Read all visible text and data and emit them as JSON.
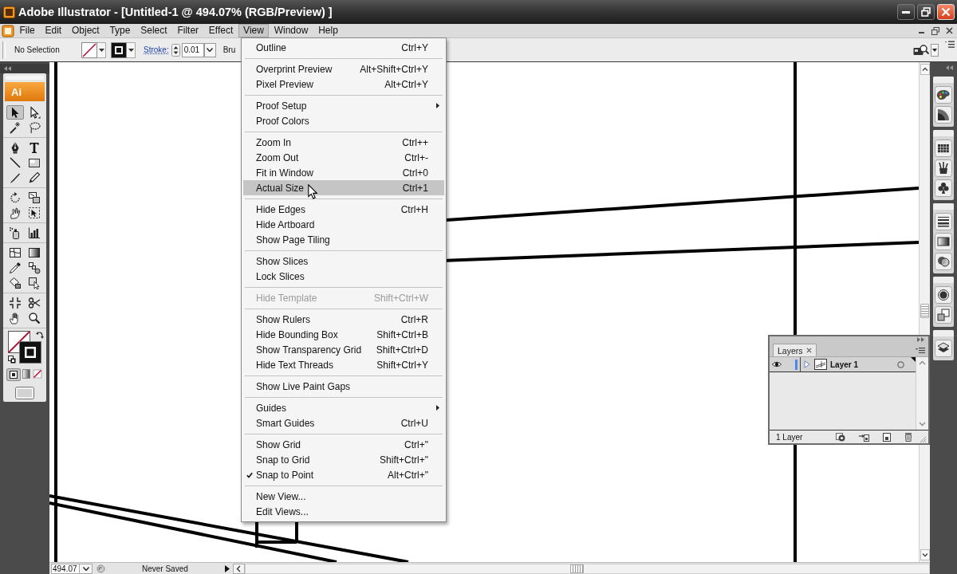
{
  "window": {
    "title": "Adobe Illustrator - [Untitled-1 @ 494.07% (RGB/Preview) ]"
  },
  "menu_bar": [
    {
      "label": "File",
      "selected": false
    },
    {
      "label": "Edit",
      "selected": false
    },
    {
      "label": "Object",
      "selected": false
    },
    {
      "label": "Type",
      "selected": false
    },
    {
      "label": "Select",
      "selected": false
    },
    {
      "label": "Filter",
      "selected": false
    },
    {
      "label": "Effect",
      "selected": false
    },
    {
      "label": "View",
      "selected": true
    },
    {
      "label": "Window",
      "selected": false
    },
    {
      "label": "Help",
      "selected": false
    }
  ],
  "control_bar": {
    "selection_status": "No Selection",
    "stroke_label": "Stroke:",
    "stroke_weight": "0.01",
    "label_4": "Bru"
  },
  "toolbox": {
    "logo": "Ai",
    "tool_groups": [
      [
        {
          "kind": "arrow",
          "selected": true
        },
        {
          "kind": "hollowarrow",
          "selected": false
        },
        {
          "kind": "wand",
          "selected": false
        },
        {
          "kind": "lasso",
          "selected": false
        }
      ],
      [
        {
          "kind": "pen",
          "selected": false
        },
        {
          "kind": "type",
          "selected": false
        },
        {
          "kind": "line",
          "selected": false
        },
        {
          "kind": "rectangle",
          "selected": false
        },
        {
          "kind": "brush",
          "selected": false
        },
        {
          "kind": "pencil",
          "selected": false
        }
      ],
      [
        {
          "kind": "rotate",
          "selected": false
        },
        {
          "kind": "scale",
          "selected": false
        },
        {
          "kind": "warp",
          "selected": false
        },
        {
          "kind": "freetransform",
          "selected": false
        }
      ],
      [
        {
          "kind": "sprayer",
          "selected": false
        },
        {
          "kind": "graph",
          "selected": false
        }
      ],
      [
        {
          "kind": "mesh",
          "selected": false
        },
        {
          "kind": "gradient",
          "selected": false
        },
        {
          "kind": "eyedropper",
          "selected": false
        },
        {
          "kind": "blend",
          "selected": false
        },
        {
          "kind": "bucket",
          "selected": false
        },
        {
          "kind": "paintselect",
          "selected": false
        }
      ],
      [
        {
          "kind": "slice",
          "selected": false
        },
        {
          "kind": "scissors",
          "selected": false
        },
        {
          "kind": "hand",
          "selected": false
        },
        {
          "kind": "zoom",
          "selected": false
        }
      ]
    ],
    "color_modes": [
      {
        "kind": "color",
        "selected": true
      },
      {
        "kind": "gradient",
        "selected": false
      },
      {
        "kind": "none",
        "selected": false
      }
    ]
  },
  "view_menu": {
    "groups": [
      [
        {
          "label": "Outline",
          "shortcut": "Ctrl+Y",
          "checked": false,
          "selected": false,
          "disabled": false,
          "submenu": false
        }
      ],
      [
        {
          "label": "Overprint Preview",
          "shortcut": "Alt+Shift+Ctrl+Y",
          "checked": false,
          "selected": false,
          "disabled": false,
          "submenu": false
        },
        {
          "label": "Pixel Preview",
          "shortcut": "Alt+Ctrl+Y",
          "checked": false,
          "selected": false,
          "disabled": false,
          "submenu": false
        }
      ],
      [
        {
          "label": "Proof Setup",
          "checked": false,
          "selected": false,
          "disabled": false,
          "submenu": true
        },
        {
          "label": "Proof Colors",
          "checked": false,
          "selected": false,
          "disabled": false,
          "submenu": false
        }
      ],
      [
        {
          "label": "Zoom In",
          "shortcut": "Ctrl++",
          "checked": false,
          "selected": false,
          "disabled": false,
          "submenu": false
        },
        {
          "label": "Zoom Out",
          "shortcut": "Ctrl+-",
          "checked": false,
          "selected": false,
          "disabled": false,
          "submenu": false
        },
        {
          "label": "Fit in Window",
          "shortcut": "Ctrl+0",
          "checked": false,
          "selected": false,
          "disabled": false,
          "submenu": false
        },
        {
          "label": "Actual Size",
          "shortcut": "Ctrl+1",
          "checked": false,
          "selected": true,
          "disabled": false,
          "submenu": false
        }
      ],
      [
        {
          "label": "Hide Edges",
          "shortcut": "Ctrl+H",
          "checked": false,
          "selected": false,
          "disabled": false,
          "submenu": false
        },
        {
          "label": "Hide Artboard",
          "checked": false,
          "selected": false,
          "disabled": false,
          "submenu": false
        },
        {
          "label": "Show Page Tiling",
          "checked": false,
          "selected": false,
          "disabled": false,
          "submenu": false
        }
      ],
      [
        {
          "label": "Show Slices",
          "checked": false,
          "selected": false,
          "disabled": false,
          "submenu": false
        },
        {
          "label": "Lock Slices",
          "checked": false,
          "selected": false,
          "disabled": false,
          "submenu": false
        }
      ],
      [
        {
          "label": "Hide Template",
          "shortcut": "Shift+Ctrl+W",
          "checked": false,
          "selected": false,
          "disabled": true,
          "submenu": false
        }
      ],
      [
        {
          "label": "Show Rulers",
          "shortcut": "Ctrl+R",
          "checked": false,
          "selected": false,
          "disabled": false,
          "submenu": false
        },
        {
          "label": "Hide Bounding Box",
          "shortcut": "Shift+Ctrl+B",
          "checked": false,
          "selected": false,
          "disabled": false,
          "submenu": false
        },
        {
          "label": "Show Transparency Grid",
          "shortcut": "Shift+Ctrl+D",
          "checked": false,
          "selected": false,
          "disabled": false,
          "submenu": false
        },
        {
          "label": "Hide Text Threads",
          "shortcut": "Shift+Ctrl+Y",
          "checked": false,
          "selected": false,
          "disabled": false,
          "submenu": false
        }
      ],
      [
        {
          "label": "Show Live Paint Gaps",
          "checked": false,
          "selected": false,
          "disabled": false,
          "submenu": false
        }
      ],
      [
        {
          "label": "Guides",
          "checked": false,
          "selected": false,
          "disabled": false,
          "submenu": true
        },
        {
          "label": "Smart Guides",
          "shortcut": "Ctrl+U",
          "checked": false,
          "selected": false,
          "disabled": false,
          "submenu": false
        }
      ],
      [
        {
          "label": "Show Grid",
          "shortcut": "Ctrl+\"",
          "checked": false,
          "selected": false,
          "disabled": false,
          "submenu": false
        },
        {
          "label": "Snap to Grid",
          "shortcut": "Shift+Ctrl+\"",
          "checked": false,
          "selected": false,
          "disabled": false,
          "submenu": false
        },
        {
          "label": "Snap to Point",
          "shortcut": "Alt+Ctrl+\"",
          "checked": true,
          "selected": false,
          "disabled": false,
          "submenu": false
        }
      ],
      [
        {
          "label": "New View...",
          "checked": false,
          "selected": false,
          "disabled": false,
          "submenu": false
        },
        {
          "label": "Edit Views...",
          "checked": false,
          "selected": false,
          "disabled": false,
          "submenu": false
        }
      ]
    ]
  },
  "layers_panel": {
    "tab": "Layers",
    "layers": [
      {
        "name": "Layer 1",
        "visible": true,
        "expanded": false,
        "selected": true,
        "color": "#4f86e8"
      }
    ],
    "footer": "1 Layer"
  },
  "status_bar": {
    "zoom": "494.07",
    "document_status": "Never Saved"
  }
}
